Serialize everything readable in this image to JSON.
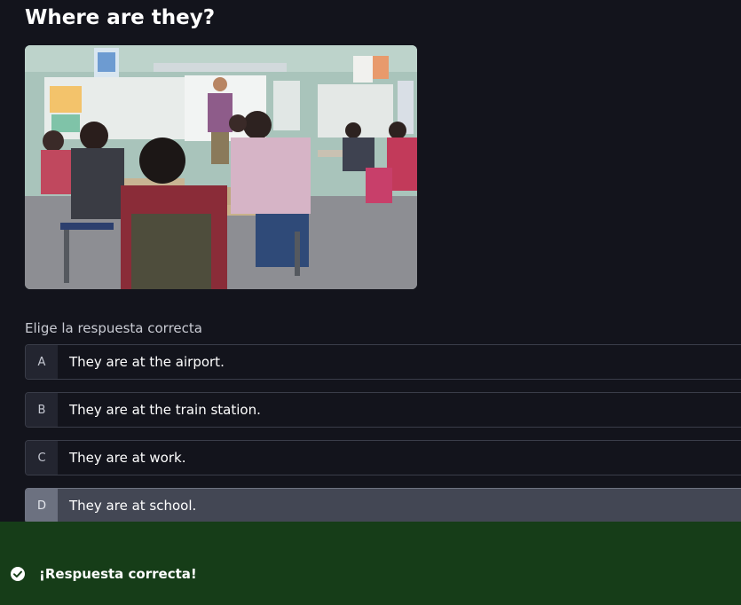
{
  "question": {
    "title": "Where are they?",
    "image_alt": "classroom-photo"
  },
  "instruction": "Elige la respuesta correcta",
  "answers": [
    {
      "letter": "A",
      "text": "They are at the airport."
    },
    {
      "letter": "B",
      "text": "They are at the train station."
    },
    {
      "letter": "C",
      "text": "They are at work."
    },
    {
      "letter": "D",
      "text": "They are at school."
    }
  ],
  "selected_answer": "D",
  "feedback": {
    "icon": "check-circle-icon",
    "text": "¡Respuesta correcta!",
    "color": "#163d18"
  }
}
